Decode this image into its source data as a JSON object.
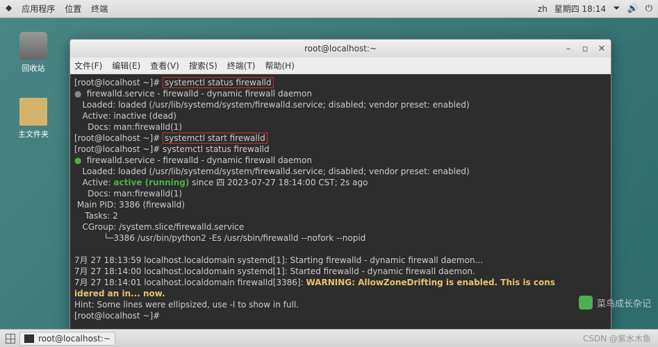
{
  "topbar": {
    "apps": "应用程序",
    "places": "位置",
    "terminal": "终端",
    "lang": "zh",
    "date": "星期四 18:14"
  },
  "desktop": {
    "trash": "回收站",
    "home": "主文件夹"
  },
  "window": {
    "title": "root@localhost:~",
    "menu": {
      "file": "文件(F)",
      "edit": "编辑(E)",
      "view": "查看(V)",
      "search": "搜索(S)",
      "terminal": "终端(T)",
      "help": "帮助(H)"
    }
  },
  "term": {
    "p1": "[root@localhost ~]# ",
    "c1": "systemctl status firewalld",
    "l1": "firewalld.service - firewalld - dynamic firewall daemon",
    "l2": "   Loaded: loaded (/usr/lib/systemd/system/firewalld.service; disabled; vendor preset: enabled)",
    "l3": "   Active: inactive (dead)",
    "l4": "     Docs: man:firewalld(1)",
    "p2": "[root@localhost ~]# ",
    "c2": "systemctl start firewalld",
    "p3": "[root@localhost ~]# ",
    "c3": "systemctl status firewalld",
    "l5": "firewalld.service - firewalld - dynamic firewall daemon",
    "l6": "   Loaded: loaded (/usr/lib/systemd/system/firewalld.service; disabled; vendor preset: enabled)",
    "l7a": "   Active: ",
    "l7b": "active (running)",
    "l7c": " since 四 2023-07-27 18:14:00 CST; 2s ago",
    "l8": "     Docs: man:firewalld(1)",
    "l9": " Main PID: 3386 (firewalld)",
    "l10": "    Tasks: 2",
    "l11": "   CGroup: /system.slice/firewalld.service",
    "l12": "           └─3386 /usr/bin/python2 -Es /usr/sbin/firewalld --nofork --nopid",
    "blank": "",
    "log1": "7月 27 18:13:59 localhost.localdomain systemd[1]: Starting firewalld - dynamic firewall daemon...",
    "log2": "7月 27 18:14:00 localhost.localdomain systemd[1]: Started firewalld - dynamic firewall daemon.",
    "log3a": "7月 27 18:14:01 localhost.localdomain firewalld[3386]: ",
    "log3b": "WARNING: AllowZoneDrifting is enabled. This is cons",
    "log3c": "idered an in... now.",
    "hint": "Hint: Some lines were ellipsized, use -l to show in full.",
    "p4": "[root@localhost ~]# "
  },
  "taskbar": {
    "item": "root@localhost:~"
  },
  "watermark": {
    "text": "菜鸟成长杂记",
    "csdn": "CSDN @紫水木鱼"
  }
}
